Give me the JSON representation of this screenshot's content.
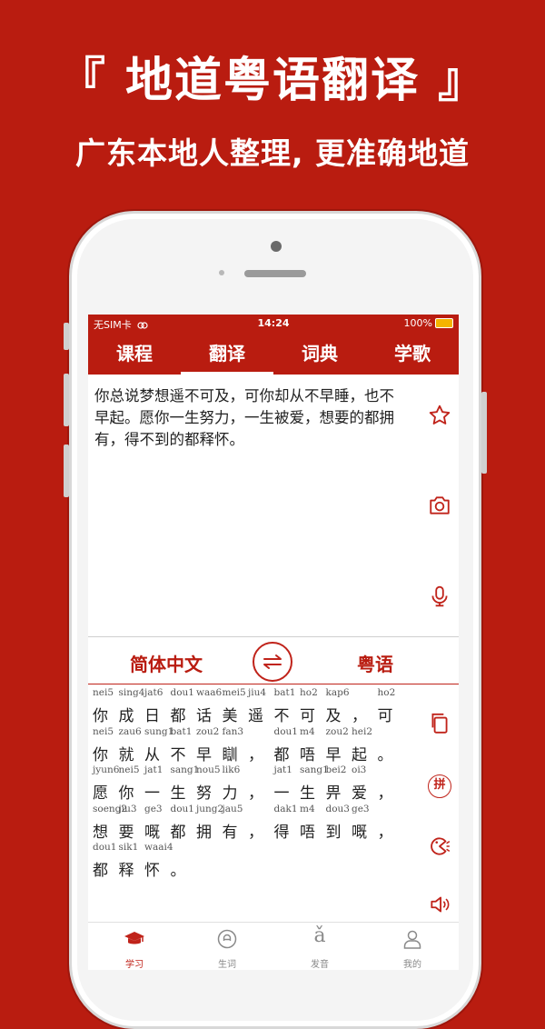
{
  "promo": {
    "headline": "『 地道粤语翻译 』",
    "subline": "广东本地人整理, 更准确地道"
  },
  "colors": {
    "brand": "#b91c10",
    "accent": "#c0231a",
    "text": "#222222"
  },
  "status_bar": {
    "carrier": "无SIM卡",
    "time": "14:24",
    "battery": "100%"
  },
  "tabs": [
    {
      "label": "课程"
    },
    {
      "label": "翻译",
      "active": true
    },
    {
      "label": "词典"
    },
    {
      "label": "学歌"
    }
  ],
  "input": {
    "text": "你总说梦想遥不可及，可你却从不早睡，也不早起。愿你一生努力，一生被爱，想要的都拥有，得不到的都释怀。"
  },
  "input_tools": [
    "star-icon",
    "camera-icon",
    "microphone-icon"
  ],
  "languages": {
    "source": "简体中文",
    "target": "粤语",
    "swap_icon": "swap-arrows-icon"
  },
  "result": {
    "lines": [
      {
        "tokens": [
          {
            "py": "nei5",
            "hz": "你"
          },
          {
            "py": "sing4",
            "hz": "成"
          },
          {
            "py": "jat6",
            "hz": "日"
          },
          {
            "py": "dou1",
            "hz": "都"
          },
          {
            "py": "waa6",
            "hz": "话"
          },
          {
            "py": "mei5",
            "hz": "美"
          },
          {
            "py": "jiu4",
            "hz": "遥"
          },
          {
            "py": "bat1",
            "hz": "不"
          },
          {
            "py": "ho2",
            "hz": "可"
          },
          {
            "py": "kap6",
            "hz": "及"
          },
          {
            "py": "",
            "hz": "，"
          },
          {
            "py": "ho2",
            "hz": "可"
          }
        ]
      },
      {
        "tokens": [
          {
            "py": "nei5",
            "hz": "你"
          },
          {
            "py": "zau6",
            "hz": "就"
          },
          {
            "py": "sung1",
            "hz": "从"
          },
          {
            "py": "bat1",
            "hz": "不"
          },
          {
            "py": "zou2",
            "hz": "早"
          },
          {
            "py": "fan3",
            "hz": "瞓"
          },
          {
            "py": "",
            "hz": "，"
          },
          {
            "py": "dou1",
            "hz": "都"
          },
          {
            "py": "m4",
            "hz": "唔"
          },
          {
            "py": "zou2",
            "hz": "早"
          },
          {
            "py": "hei2",
            "hz": "起"
          },
          {
            "py": "",
            "hz": "。"
          }
        ]
      },
      {
        "tokens": [
          {
            "py": "jyun6",
            "hz": "愿"
          },
          {
            "py": "nei5",
            "hz": "你"
          },
          {
            "py": "jat1",
            "hz": "一"
          },
          {
            "py": "sang1",
            "hz": "生"
          },
          {
            "py": "nou5",
            "hz": "努"
          },
          {
            "py": "lik6",
            "hz": "力"
          },
          {
            "py": "",
            "hz": "，"
          },
          {
            "py": "jat1",
            "hz": "一"
          },
          {
            "py": "sang1",
            "hz": "生"
          },
          {
            "py": "bei2",
            "hz": "畀"
          },
          {
            "py": "oi3",
            "hz": "爱"
          },
          {
            "py": "",
            "hz": "，"
          }
        ]
      },
      {
        "tokens": [
          {
            "py": "soeng2",
            "hz": "想"
          },
          {
            "py": "jiu3",
            "hz": "要"
          },
          {
            "py": "ge3",
            "hz": "嘅"
          },
          {
            "py": "dou1",
            "hz": "都"
          },
          {
            "py": "jung2",
            "hz": "拥"
          },
          {
            "py": "jau5",
            "hz": "有"
          },
          {
            "py": "",
            "hz": "，"
          },
          {
            "py": "dak1",
            "hz": "得"
          },
          {
            "py": "m4",
            "hz": "唔"
          },
          {
            "py": "dou3",
            "hz": "到"
          },
          {
            "py": "ge3",
            "hz": "嘅"
          },
          {
            "py": "",
            "hz": "，"
          }
        ]
      },
      {
        "tokens": [
          {
            "py": "dou1",
            "hz": "都"
          },
          {
            "py": "sik1",
            "hz": "释"
          },
          {
            "py": "waai4",
            "hz": "怀"
          },
          {
            "py": "",
            "hz": "。"
          }
        ]
      }
    ]
  },
  "result_tools": [
    "copy-icon",
    "pinyin-icon",
    "slow-speech-icon",
    "speaker-icon"
  ],
  "pinyin_icon_text": "拼",
  "bottom_nav": [
    {
      "label": "学习",
      "icon": "graduation-cap-icon",
      "active": true
    },
    {
      "label": "生词",
      "icon": "word-book-icon"
    },
    {
      "label": "发音",
      "icon": "pronunciation-icon",
      "glyph": "ǎ"
    },
    {
      "label": "我的",
      "icon": "profile-icon"
    }
  ]
}
